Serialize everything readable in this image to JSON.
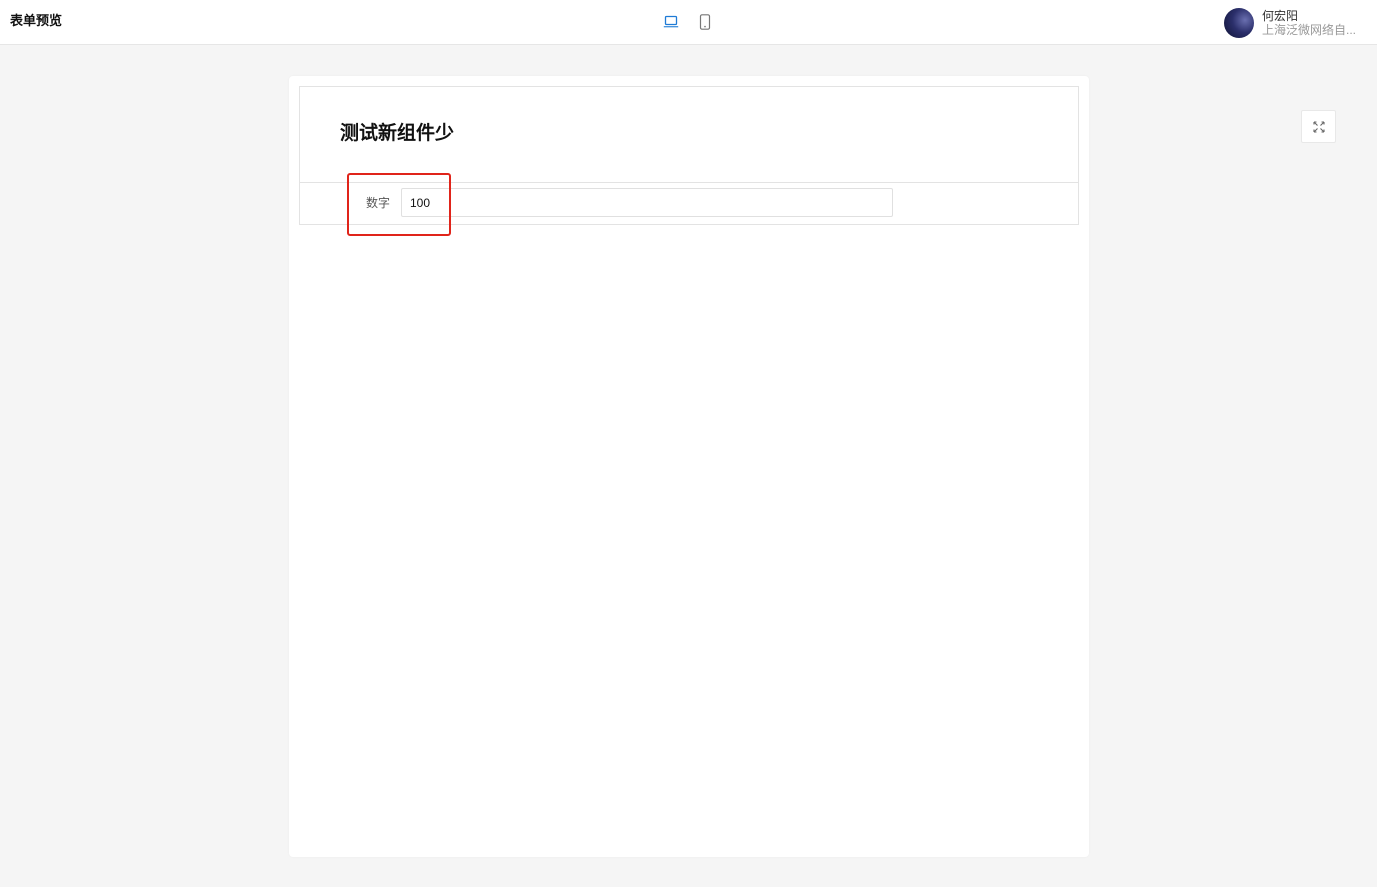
{
  "header": {
    "app_title": "表单预览",
    "device_modes": [
      {
        "name": "desktop",
        "icon": "laptop-icon",
        "active": true
      },
      {
        "name": "mobile",
        "icon": "phone-icon",
        "active": false
      }
    ],
    "user": {
      "name": "何宏阳",
      "organization": "上海泛微网络自..."
    }
  },
  "form": {
    "title": "测试新组件少",
    "fields": [
      {
        "label": "数字",
        "value": "100"
      }
    ]
  },
  "toolbar": {
    "fullscreen_icon": "expand-icon"
  },
  "colors": {
    "accent": "#1e7bd6",
    "highlight": "#e0241a",
    "background": "#f5f5f5"
  }
}
